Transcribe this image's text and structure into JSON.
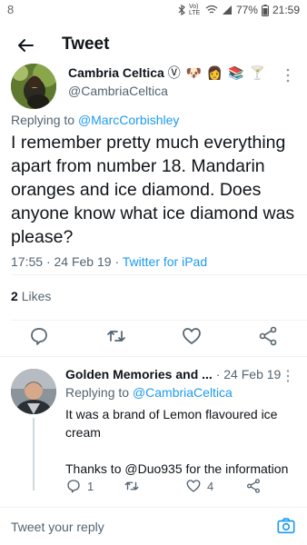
{
  "status_bar": {
    "left_indicator": "8",
    "network": "Vo) LTE",
    "battery": "77%",
    "time": "21:59"
  },
  "header": {
    "title": "Tweet",
    "back_icon": "arrow-left-icon"
  },
  "main_tweet": {
    "author_name": "Cambria Celtica",
    "name_emojis": "Ⓥ 🐶 👩 📚 🍸",
    "handle": "@CambriaCeltica",
    "replying_label": "Replying to",
    "replying_handle": "@MarcCorbishley",
    "text": "I remember pretty much everything apart from number 18. Mandarin oranges and ice diamond. Does anyone know what ice diamond was please?",
    "time": "17:55",
    "date": "24 Feb 19",
    "source": "Twitter for iPad",
    "likes_count": "2",
    "likes_label": "Likes"
  },
  "reply_tweet": {
    "author_name": "Golden Memories and ...",
    "date": "24 Feb 19",
    "replying_label": "Replying to",
    "replying_handle": "@CambriaCeltica",
    "text_line1": "It was a brand of Lemon flavoured ice cream",
    "text_line2_prefix": "Thanks to ",
    "text_line2_mention": "@Duo935",
    "text_line2_suffix": " for the information",
    "reply_count": "1",
    "retweet_count": "",
    "like_count": "4"
  },
  "composer": {
    "placeholder": "Tweet your reply"
  },
  "colors": {
    "link": "#1d9bf0",
    "secondary_text": "#536471",
    "primary_text": "#0f1419"
  }
}
